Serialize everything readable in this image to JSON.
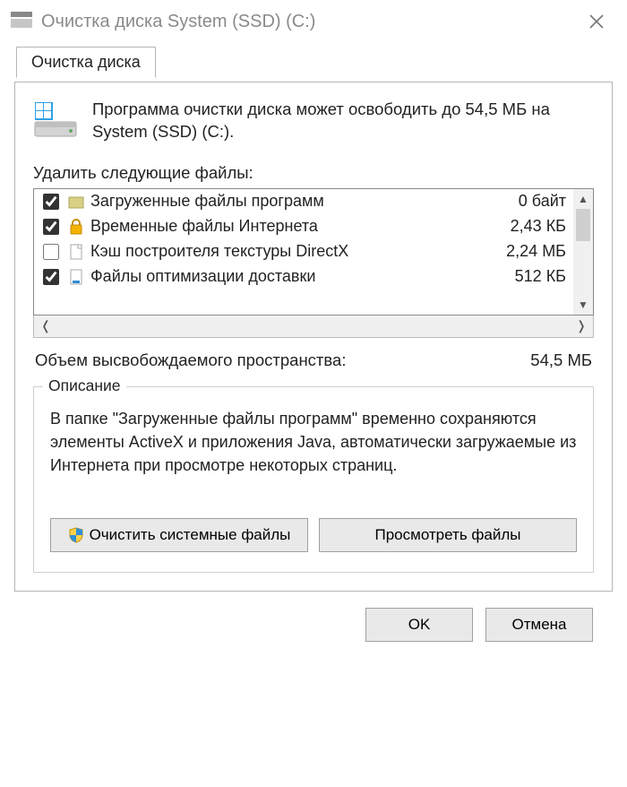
{
  "window": {
    "title": "Очистка диска System (SSD) (C:)"
  },
  "tab": {
    "label": "Очистка диска"
  },
  "intro": {
    "text": "Программа очистки диска может освободить до 54,5 МБ на System (SSD) (C:)."
  },
  "list": {
    "caption": "Удалить следующие файлы:",
    "items": [
      {
        "checked": true,
        "icon": "folder",
        "label": "Загруженные файлы программ",
        "size": "0 байт"
      },
      {
        "checked": true,
        "icon": "lock",
        "label": "Временные файлы Интернета",
        "size": "2,43 КБ"
      },
      {
        "checked": false,
        "icon": "file",
        "label": "Кэш построителя текстуры DirectX",
        "size": "2,24 МБ"
      },
      {
        "checked": true,
        "icon": "file-dl",
        "label": "Файлы оптимизации доставки",
        "size": "512 КБ"
      }
    ]
  },
  "summary": {
    "label": "Объем высвобождаемого пространства:",
    "value": "54,5 МБ"
  },
  "description": {
    "legend": "Описание",
    "text": "В папке \"Загруженные файлы программ\" временно сохраняются элементы ActiveX и приложения Java, автоматически загружаемые из Интернета при просмотре некоторых страниц.",
    "clean_system_label": "Очистить системные файлы",
    "view_files_label": "Просмотреть файлы"
  },
  "buttons": {
    "ok": "OK",
    "cancel": "Отмена"
  }
}
